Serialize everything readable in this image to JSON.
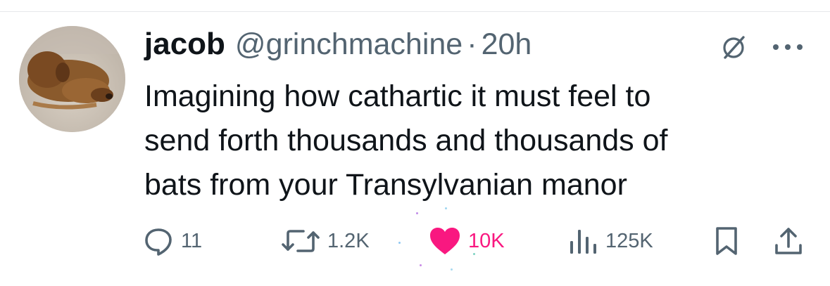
{
  "tweet": {
    "author_name": "jacob",
    "author_handle": "@grinchmachine",
    "separator": "·",
    "time": "20h",
    "body_lines": [
      "Imagining how cathartic it must feel to",
      "send forth thousands and thousands of",
      "bats from your Transylvanian manor"
    ]
  },
  "actions": {
    "replies": "11",
    "reposts": "1.2K",
    "likes": "10K",
    "views": "125K"
  },
  "icons": {
    "reply": "reply-icon",
    "repost": "repost-icon",
    "like": "heart-filled-icon",
    "views": "views-bar-chart-icon",
    "bookmark": "bookmark-icon",
    "share": "share-icon",
    "grok": "grok-icon",
    "more": "more-dots-icon"
  },
  "colors": {
    "text": "#0f1419",
    "secondary": "#536471",
    "like": "#f91880"
  }
}
